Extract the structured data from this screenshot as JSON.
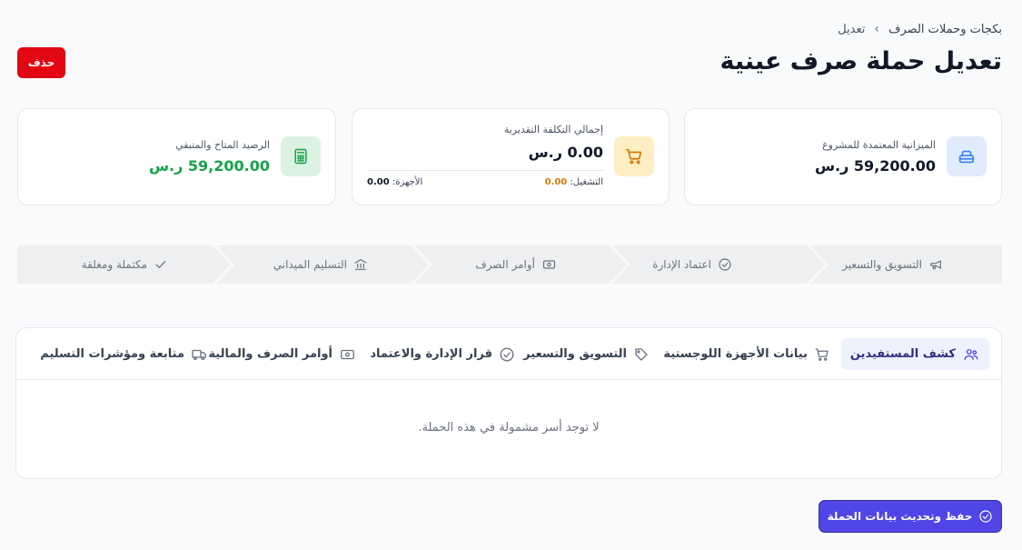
{
  "breadcrumb": {
    "parent": "بكجات وحملات الصرف",
    "separator": "›",
    "current": "تعديل"
  },
  "page_title": "تعديل حملة صرف عينية",
  "delete_label": "حذف",
  "cards": [
    {
      "label": "الميزانية المعتمدة للمشروع",
      "value": "59,200.00 ر.س",
      "icon": "box-icon"
    },
    {
      "label": "إجمالي التكلفة التقديرية",
      "value": "0.00 ر.س",
      "icon": "cart-icon",
      "running_label": "التشغيل:",
      "running_value": "0.00",
      "devices_label": "الأجهزة:",
      "devices_value": "0.00"
    },
    {
      "label": "الرصيد المتاح والمتبقي",
      "value": "59,200.00 ر.س",
      "icon": "calculator-icon"
    }
  ],
  "steps": [
    {
      "label": "التسويق والتسعير",
      "icon": "megaphone-icon"
    },
    {
      "label": "اعتماد الإدارة",
      "icon": "check-circle-icon"
    },
    {
      "label": "أوامر الصرف",
      "icon": "money-icon"
    },
    {
      "label": "التسليم الميداني",
      "icon": "building-icon"
    },
    {
      "label": "مكتملة ومغلقة",
      "icon": "check-icon"
    }
  ],
  "tabs": [
    {
      "label": "كشف المستفيدين",
      "icon": "users-icon",
      "active": true
    },
    {
      "label": "بيانات الأجهزة اللوجستية",
      "icon": "cart-icon",
      "active": false
    },
    {
      "label": "التسويق والتسعير",
      "icon": "tag-icon",
      "active": false
    },
    {
      "label": "قرار الإدارة والاعتماد",
      "icon": "check-circle-icon",
      "active": false
    },
    {
      "label": "أوامر الصرف والمالية",
      "icon": "money-icon",
      "active": false
    },
    {
      "label": "متابعة ومؤشرات التسليم",
      "icon": "truck-icon",
      "active": false
    }
  ],
  "empty_message": "لا توجد أسر مشمولة في هذه الحملة.",
  "save_label": "حفظ وتحديث بيانات الحملة",
  "colors": {
    "primary": "#4f46e5",
    "danger": "#e30613",
    "success": "#16a34a",
    "warning": "#d97706"
  }
}
